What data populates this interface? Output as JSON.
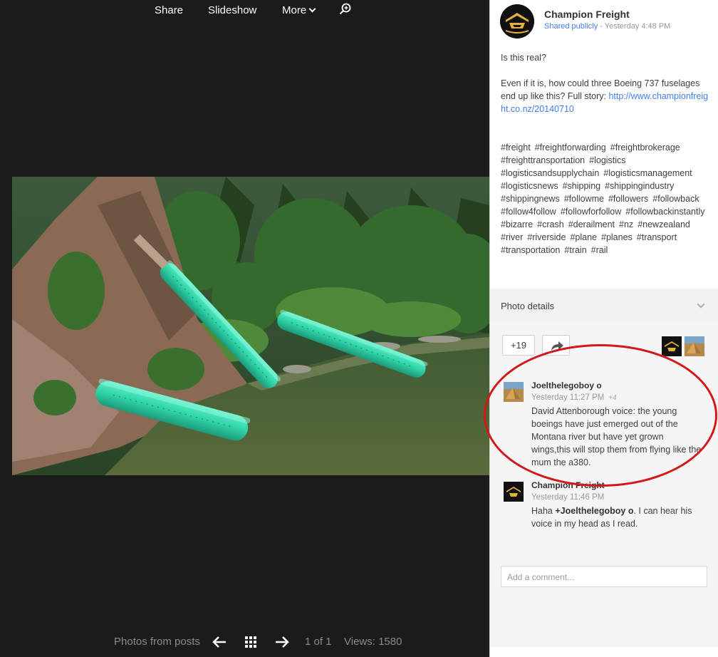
{
  "viewer": {
    "toolbar": {
      "share": "Share",
      "slideshow": "Slideshow",
      "more": "More",
      "zoom_icon": "zoom-in-icon"
    },
    "photo_alt": "Three Boeing 737 fuselages in a river",
    "footer": {
      "photos_from_posts": "Photos from posts",
      "page": "1 of 1",
      "views": "Views: 1580"
    }
  },
  "post": {
    "author": "Champion Freight",
    "visibility": "Shared publicly",
    "separator": " - ",
    "timestamp": "Yesterday 4:48 PM",
    "paragraph1": "Is this real?",
    "paragraph2": "Even if it is, how could three Boeing 737 fuselages end up like this? Full story: ",
    "link": "http://www.championfreight.co.nz/20140710",
    "hashtags": [
      "#freight",
      "#freightforwarding",
      "#freightbrokerage",
      "#freighttransportation",
      "#logistics",
      "#logisticsandsupplychain",
      "#logisticsmanagement",
      "#logisticsnews",
      "#shipping",
      "#shippingindustry",
      "#shippingnews",
      "#followme",
      "#followers",
      "#followback",
      "#follow4follow",
      "#followforfollow",
      "#followbackinstantly",
      "#bizarre",
      "#crash",
      "#derailment",
      "#nz",
      "#newzealand",
      "#river",
      "#riverside",
      "#plane",
      "#planes",
      "#transport",
      "#transportation",
      "#train",
      "#rail"
    ]
  },
  "details": {
    "label": "Photo details"
  },
  "actions": {
    "plus_count": "+19"
  },
  "comments": [
    {
      "author": "Joelthelegoboy o",
      "time": "Yesterday 11:27 PM",
      "plus": "+4",
      "text": "David Attenborough voice: the young boeings have just emerged out of the Montana river but have yet grown wings,this will stop them from flying like the mum the a380."
    },
    {
      "author": "Champion Freight",
      "time": "Yesterday 11:46 PM",
      "text_prefix": "Haha ",
      "mention": "+Joelthelegoboy o",
      "text_suffix": ". I can hear his voice in my head as I read."
    }
  ],
  "add_comment_placeholder": "Add a comment...",
  "colors": {
    "link": "#427fed",
    "annotation": "#d41717",
    "plane": "#2fd3a8"
  }
}
